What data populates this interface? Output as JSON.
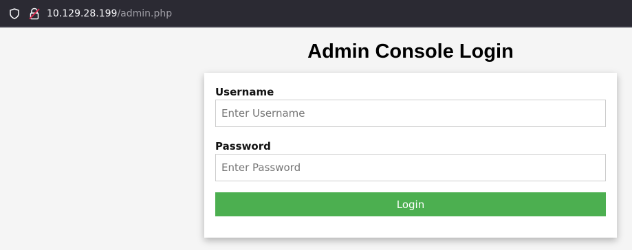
{
  "browser": {
    "url_host": "10.129.28.199",
    "url_path": "/admin.php",
    "shield_icon": "shield-icon",
    "lock_icon": "insecure-lock-icon"
  },
  "page": {
    "title": "Admin Console Login"
  },
  "form": {
    "username_label": "Username",
    "username_placeholder": "Enter Username",
    "username_value": "",
    "password_label": "Password",
    "password_placeholder": "Enter Password",
    "password_value": "",
    "login_label": "Login"
  },
  "colors": {
    "button_bg": "#4caf50",
    "page_bg": "#f5f5f5",
    "toolbar_bg": "#2b2a33"
  }
}
